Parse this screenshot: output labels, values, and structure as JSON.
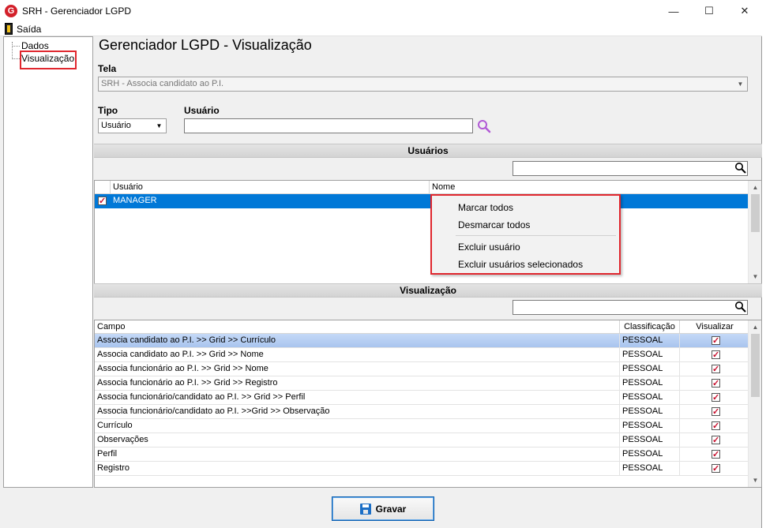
{
  "window": {
    "title": "SRH - Gerenciador LGPD",
    "app_icon_letter": "G",
    "minimize_glyph": "—",
    "maximize_glyph": "☐",
    "close_glyph": "✕"
  },
  "menu": {
    "exit_label": "Saída"
  },
  "tree": {
    "items": [
      "Dados",
      "Visualização"
    ]
  },
  "page_title": "Gerenciador LGPD - Visualização",
  "tela": {
    "label": "Tela",
    "value": "SRH - Associa candidato ao P.I."
  },
  "tipo": {
    "label": "Tipo",
    "value": "Usuário"
  },
  "usuario": {
    "label": "Usuário",
    "value": ""
  },
  "users_section": {
    "title": "Usuários",
    "columns": [
      "Usuário",
      "Nome"
    ],
    "rows": [
      {
        "checked": true,
        "usuario": "MANAGER",
        "nome": ""
      }
    ]
  },
  "context_menu": {
    "items": [
      "Marcar todos",
      "Desmarcar todos",
      "Excluir usuário",
      "Excluir usuários selecionados"
    ]
  },
  "view_section": {
    "title": "Visualização",
    "columns": [
      "Campo",
      "Classificação",
      "Visualizar"
    ],
    "rows": [
      {
        "campo": "Associa candidato ao P.I. >> Grid >> Currículo",
        "classificacao": "PESSOAL",
        "visualizar": true
      },
      {
        "campo": "Associa candidato ao P.I. >> Grid >> Nome",
        "classificacao": "PESSOAL",
        "visualizar": true
      },
      {
        "campo": "Associa funcionário ao P.I. >> Grid >> Nome",
        "classificacao": "PESSOAL",
        "visualizar": true
      },
      {
        "campo": "Associa funcionário ao P.I. >> Grid >> Registro",
        "classificacao": "PESSOAL",
        "visualizar": true
      },
      {
        "campo": "Associa funcionário/candidato ao P.I. >> Grid >> Perfil",
        "classificacao": "PESSOAL",
        "visualizar": true
      },
      {
        "campo": "Associa funcionário/candidato ao P.I. >>Grid >> Observação",
        "classificacao": "PESSOAL",
        "visualizar": true
      },
      {
        "campo": "Currículo",
        "classificacao": "PESSOAL",
        "visualizar": true
      },
      {
        "campo": "Observações",
        "classificacao": "PESSOAL",
        "visualizar": true
      },
      {
        "campo": "Perfil",
        "classificacao": "PESSOAL",
        "visualizar": true
      },
      {
        "campo": "Registro",
        "classificacao": "PESSOAL",
        "visualizar": true
      }
    ]
  },
  "save_button": {
    "label": "Gravar"
  },
  "colors": {
    "selection": "#0078d7",
    "highlight_border": "#e0272e",
    "check": "#c8102e"
  }
}
